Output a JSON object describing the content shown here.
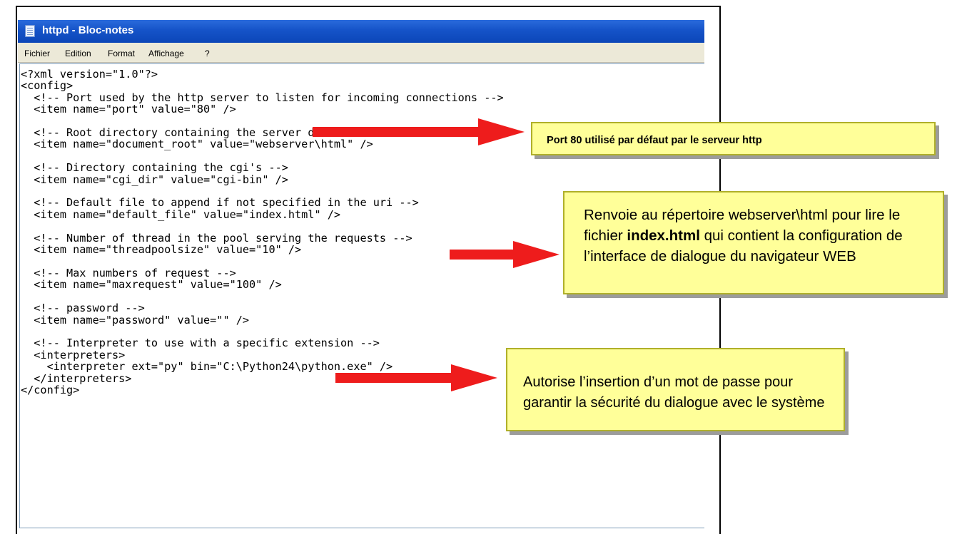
{
  "window": {
    "title": "httpd - Bloc-notes"
  },
  "menu": [
    {
      "label": "Fichier"
    },
    {
      "label": "Edition"
    },
    {
      "label": "Format"
    },
    {
      "label": "Affichage"
    },
    {
      "label": "?"
    }
  ],
  "code_lines": [
    "<?xml version=\"1.0\"?>",
    "<config>",
    "  <!-- Port used by the http server to listen for incoming connections -->",
    "  <item name=\"port\" value=\"80\" />",
    "",
    "  <!-- Root directory containing the server document -->",
    "  <item name=\"document_root\" value=\"webserver\\html\" />",
    "",
    "  <!-- Directory containing the cgi's -->",
    "  <item name=\"cgi_dir\" value=\"cgi-bin\" />",
    "",
    "  <!-- Default file to append if not specified in the uri -->",
    "  <item name=\"default_file\" value=\"index.html\" />",
    "",
    "  <!-- Number of thread in the pool serving the requests -->",
    "  <item name=\"threadpoolsize\" value=\"10\" />",
    "",
    "  <!-- Max numbers of request -->",
    "  <item name=\"maxrequest\" value=\"100\" />",
    "",
    "  <!-- password -->",
    "  <item name=\"password\" value=\"\" />",
    "",
    "  <!-- Interpreter to use with a specific extension -->",
    "  <interpreters>",
    "    <interpreter ext=\"py\" bin=\"C:\\Python24\\python.exe\" />",
    "  </interpreters>",
    "</config>"
  ],
  "callouts": {
    "port": {
      "text": "Port 80 utilisé par défaut par le serveur http"
    },
    "index": {
      "part1": "Renvoie au répertoire webserver\\html pour lire le fichier ",
      "bold": "index.html",
      "part2": " qui contient la configuration de l’interface de dialogue du navigateur WEB"
    },
    "password": {
      "text": "Autorise l’insertion d’un mot de passe pour garantir la sécurité du dialogue avec le système"
    }
  },
  "colors": {
    "titlebar": "#1553c8",
    "menubar": "#ece9d8",
    "arrow": "#ee1c1c",
    "callout_fill": "#ffff99"
  },
  "icons": {
    "app": "notepad-icon",
    "annotation": "arrow-right-icon"
  }
}
